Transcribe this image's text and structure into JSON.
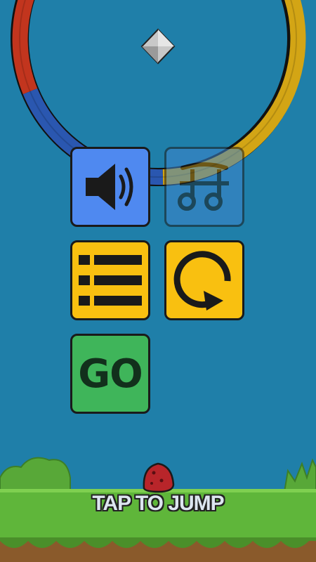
{
  "controls": {
    "sound": {
      "icon": "speaker-icon"
    },
    "music": {
      "icon": "music-notes-icon",
      "state": "disabled"
    },
    "menu": {
      "icon": "list-icon"
    },
    "restart": {
      "icon": "restart-icon"
    },
    "go": {
      "label": "GO"
    }
  },
  "hint": {
    "text": "TAP TO JUMP"
  },
  "ring_colors": [
    "#2a57b0",
    "#c2351e",
    "#d3a515"
  ],
  "colors": {
    "background": "#1f7fa9",
    "sound_button": "#4f89f0",
    "menu_button": "#f9c010",
    "go_button": "#3fb55a",
    "player": "#b8252a",
    "ground": "#5fb63a"
  }
}
